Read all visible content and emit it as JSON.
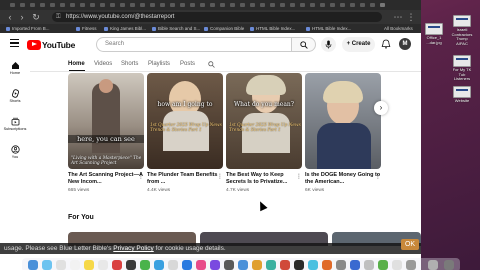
{
  "browser": {
    "url": "https://www.youtube.com/@thestarreport",
    "bookmarks": [
      "Imported From B...",
      "Fitness",
      "King James Bibl...",
      "Bible Search and S...",
      "Companion Bible",
      "HTML Bible Index...",
      "HTML Bible Index...",
      "All Bookmarks"
    ]
  },
  "header": {
    "logo_text": "YouTube",
    "search_placeholder": "Search",
    "create_label": "Create",
    "avatar_initial": "M"
  },
  "left_nav": [
    {
      "label": "Home",
      "icon": "home-icon"
    },
    {
      "label": "Shorts",
      "icon": "shorts-icon"
    },
    {
      "label": "Subscriptions",
      "icon": "subscriptions-icon"
    },
    {
      "label": "You",
      "icon": "you-icon"
    }
  ],
  "channel_tabs": [
    "Home",
    "Videos",
    "Shorts",
    "Playlists",
    "Posts"
  ],
  "shorts": [
    {
      "title": "The Art Scanning Project—A New Incom...",
      "views": "665 views",
      "caption": "here, you can see",
      "overlay": "\"Living with a Masterpiece\" The Art Scanning Project"
    },
    {
      "title": "The Plunder Team Benefits from ...",
      "views": "4.4K views",
      "caption": "how am I going to",
      "overlay": "1st Quarter 2025 Wrap Up News Trends & Stories Part 1"
    },
    {
      "title": "The Best Way to Keep Secrets Is to Privatize...",
      "views": "4.7K views",
      "caption": "What do you mean?",
      "overlay": "1st Quarter 2025 Wrap Up News Trends & Stories Part 1"
    },
    {
      "title": "Is the DOGE Money Going to the American...",
      "views": "6K views",
      "caption": "",
      "overlay": ""
    }
  ],
  "for_you_title": "For You",
  "cookie_bar": {
    "prefix": "usage. Please see Blue Letter Bible's ",
    "link": "Privacy Policy",
    "suffix": " for cookie usage details.",
    "ok": "OK"
  },
  "desktop_files": [
    {
      "label": "Office_1 ...dar.jpg"
    },
    {
      "label": "Israeli Contractors Trump AIPAC"
    },
    {
      "label": "For My TK Tub Listeners"
    },
    {
      "label": "Website"
    }
  ],
  "colors": {
    "youtube_red": "#ff0000",
    "wallpaper": "#6e2a55"
  }
}
